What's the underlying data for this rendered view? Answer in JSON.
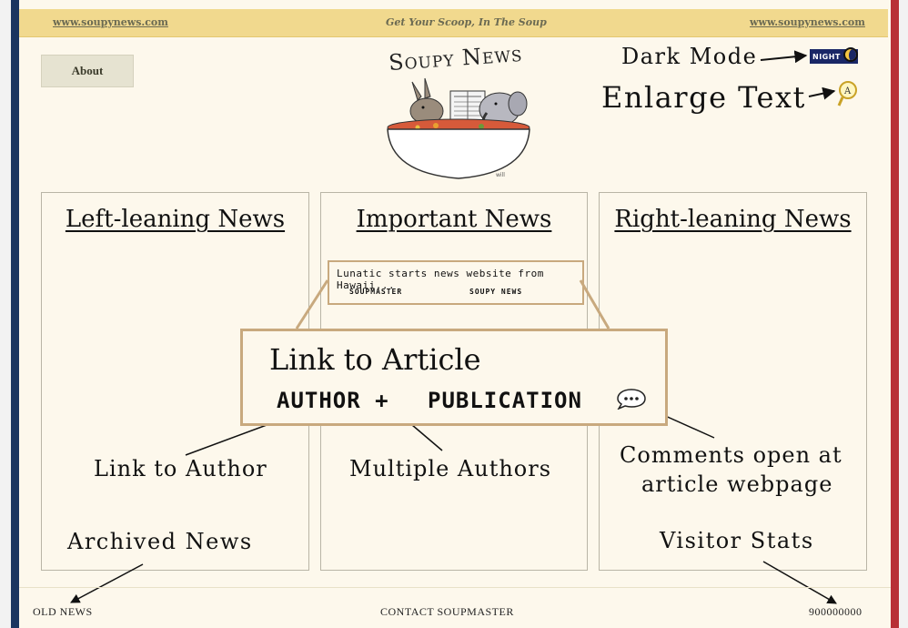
{
  "topbar": {
    "left_link": "www.soupynews.com",
    "tagline": "Get Your Scoop, In The Soup",
    "right_link": "www.soupynews.com"
  },
  "nav": {
    "about_label": "About"
  },
  "logo": {
    "title": "Soupy News"
  },
  "controls": {
    "night_button_label": "NIGHT",
    "dark_mode_annotation": "Dark Mode",
    "enlarge_text_annotation": "Enlarge Text",
    "enlarge_icon": "magnifier-A-icon"
  },
  "columns": [
    {
      "title": "Left-leaning News"
    },
    {
      "title": "Important News"
    },
    {
      "title": "Right-leaning News"
    }
  ],
  "article_card": {
    "title": "Lunatic starts news website from Hawaii...",
    "author": "SOUPMASTER",
    "publication": "SOUPY NEWS"
  },
  "zoom": {
    "title": "Link to Article",
    "author": "AUTHOR",
    "plus": "+",
    "publication": "PUBLICATION",
    "comment_icon": "speech-bubble-icon"
  },
  "annotations": {
    "link_to_author": "Link to Author",
    "multiple_authors": "Multiple Authors",
    "comments_line1": "Comments open at",
    "comments_line2": "article webpage",
    "archived_news": "Archived News",
    "visitor_stats": "Visitor Stats"
  },
  "footer": {
    "old_news": "OLD NEWS",
    "contact": "CONTACT SOUPMASTER",
    "visitor_count": "900000000"
  },
  "colors": {
    "topbar": "#f1d98e",
    "page": "#fdf8ec",
    "left_stripe": "#1b3560",
    "right_stripe": "#b83036",
    "card_border": "#c8a97e",
    "night_button": "#1a2766"
  }
}
